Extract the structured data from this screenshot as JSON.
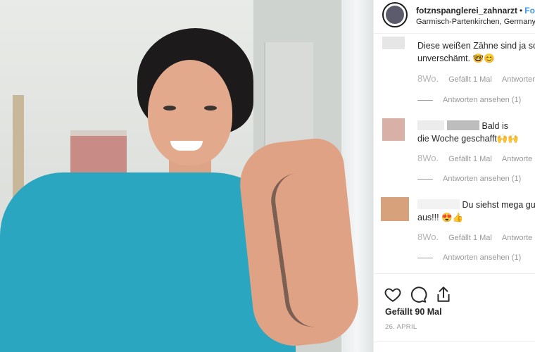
{
  "header": {
    "username": "fotznspanglerei_zahnarzt",
    "separator": "•",
    "follow_label": "Fo",
    "location": "Garmisch-Partenkirchen, Germany"
  },
  "comments": [
    {
      "text_line1": "Diese weißen Zähne sind ja sch",
      "text_line2": "unverschämt. 🤓😊",
      "age": "8Wo.",
      "likes": "Gefällt 1 Mal",
      "reply": "Antworten",
      "view_replies": "Antworten ansehen (1)",
      "avatar_color": "#e6e6e6"
    },
    {
      "text_line1": "Bald is",
      "text_line2": "die Woche geschafft🙌🙌",
      "age": "8Wo.",
      "likes": "Gefällt 1 Mal",
      "reply": "Antworte",
      "view_replies": "Antworten ansehen (1)",
      "avatar_color": "#d8b0a6"
    },
    {
      "text_line1": "Du siehst mega gut",
      "text_line2": "aus!!! 😍👍",
      "age": "8Wo.",
      "likes": "Gefällt 1 Mal",
      "reply": "Antworte",
      "view_replies": "Antworten ansehen (1)",
      "avatar_color": "#d7a27b"
    }
  ],
  "actions": {
    "like_icon": "heart-icon",
    "comment_icon": "comment-bubble-icon",
    "share_icon": "share-upload-icon",
    "likes_count": "Gefällt 90 Mal",
    "date": "26. APRIL"
  },
  "colors": {
    "accent_blue": "#3897f0",
    "text_dark": "#262626",
    "text_muted": "#999999",
    "scrubs": "#2aa6c0"
  }
}
